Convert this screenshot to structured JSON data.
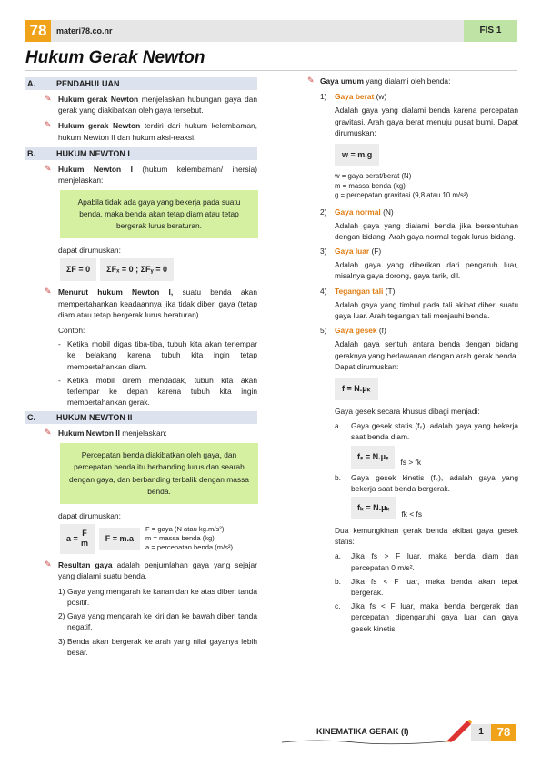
{
  "header": {
    "logo": "78",
    "site": "materi78.co.nr",
    "code": "FIS 1",
    "title": "Hukum Gerak Newton"
  },
  "secA": {
    "num": "A.",
    "title": "PENDAHULUAN",
    "p1_bold": "Hukum gerak Newton",
    "p1": " menjelaskan hubungan gaya dan gerak yang diakibatkan oleh gaya tersebut.",
    "p2_bold": "Hukum gerak Newton",
    "p2": " terdiri dari hukum kelembaman, hukum Newton II dan hukum aksi-reaksi."
  },
  "secB": {
    "num": "B.",
    "title": "HUKUM NEWTON I",
    "p1_bold": "Hukum Newton I",
    "p1": " (hukum kelembaman/ inersia) menjelaskan:",
    "box": "Apabila tidak ada gaya yang bekerja pada suatu benda, maka benda akan tetap diam atau tetap bergerak lurus beraturan.",
    "dirumuskan": "dapat dirumuskan:",
    "f1": "ΣF = 0",
    "f2": "ΣFₓ = 0 ; ΣFᵧ = 0",
    "p2_bold": "Menurut hukum Newton I,",
    "p2": " suatu benda akan mempertahankan keadaannya jika tidak diberi gaya (tetap diam atau tetap bergerak lurus beraturan).",
    "contoh": "Contoh:",
    "ex1": "Ketika mobil digas tiba-tiba, tubuh kita akan terlempar ke belakang karena tubuh kita ingin tetap mempertahankan diam.",
    "ex2": "Ketika mobil direm mendadak, tubuh kita akan terlempar ke depan karena tubuh kita ingin mempertahankan gerak."
  },
  "secC": {
    "num": "C.",
    "title": "HUKUM NEWTON II",
    "p1_bold": "Hukum Newton II",
    "p1": " menjelaskan:",
    "box": "Percepatan benda diakibatkan oleh gaya, dan percepatan benda itu berbanding lurus dan searah dengan gaya, dan berbanding terbalik dengan massa benda.",
    "dirumuskan": "dapat dirumuskan:",
    "fa": "a =",
    "fnum": "F",
    "fden": "m",
    "fb": "F = m.a",
    "leg1": "F = gaya (N atau kg.m/s²)",
    "leg2": "m = massa benda (kg)",
    "leg3": "a = percepatan benda (m/s²)",
    "p2_bold": "Resultan gaya",
    "p2": " adalah penjumlahan gaya yang sejajar yang dialami suatu benda.",
    "n1": "1)",
    "i1": "Gaya yang mengarah ke kanan dan ke atas diberi tanda positif.",
    "n2": "2)",
    "i2": "Gaya yang mengarah ke kiri dan ke bawah diberi tanda negatif.",
    "n3": "3)",
    "i3": "Benda akan bergerak ke arah yang nilai gayanya lebih besar."
  },
  "right": {
    "intro_bold": "Gaya umum",
    "intro": " yang dialami oleh benda:",
    "n1": "1)",
    "h1": "Gaya berat",
    "s1": " (w)",
    "t1": "Adalah gaya yang dialami benda karena percepatan gravitasi. Arah gaya berat menuju pusat bumi. Dapat dirumuskan:",
    "f1": "w = m.g",
    "l1a": "w = gaya berat/berat (N)",
    "l1b": "m = massa benda (kg)",
    "l1c": "g = percepatan gravitasi (9,8 atau 10 m/s²)",
    "n2": "2)",
    "h2": "Gaya normal",
    "s2": " (N)",
    "t2": "Adalah gaya yang dialami benda jika bersentuhan dengan bidang. Arah gaya normal tegak lurus bidang.",
    "n3": "3)",
    "h3": "Gaya luar",
    "s3": " (F)",
    "t3": "Adalah gaya yang diberikan dari pengaruh luar, misalnya gaya dorong, gaya tarik, dll.",
    "n4": "4)",
    "h4": "Tegangan tali",
    "s4": " (T)",
    "t4": "Adalah gaya yang timbul pada tali akibat diberi suatu gaya luar. Arah tegangan tali menjauhi benda.",
    "n5": "5)",
    "h5": "Gaya gesek",
    "s5": " (f)",
    "t5": "Adalah gaya sentuh antara benda dengan bidang geraknya yang berlawanan dengan arah gerak benda. Dapat dirumuskan:",
    "f5": "f = N.μₖ",
    "t6": "Gaya gesek secara khusus dibagi menjadi:",
    "a": "a.",
    "ta": "Gaya gesek statis (fₛ), adalah gaya yang bekerja saat benda diam.",
    "fa": "fₛ = N.μₛ",
    "ca": "fs > fk",
    "b": "b.",
    "tb": "Gaya gesek kinetis (fₖ), adalah gaya yang bekerja saat benda bergerak.",
    "fb": "fₖ = N.μₖ",
    "cb": "fk < fs",
    "t7": "Dua kemungkinan gerak benda akibat gaya gesek statis:",
    "qa": "a.",
    "qta": "Jika fs > F luar, maka benda diam dan percepatan 0 m/s².",
    "qb": "b.",
    "qtb": "Jika fs < F luar, maka benda akan tepat bergerak.",
    "qc": "c.",
    "qtc": "Jika fs < F luar, maka benda bergerak dan percepatan dipengaruhi gaya luar dan gaya gesek kinetis."
  },
  "footer": {
    "topic": "KINEMATIKA GERAK (I)",
    "page": "1",
    "logo": "78"
  }
}
